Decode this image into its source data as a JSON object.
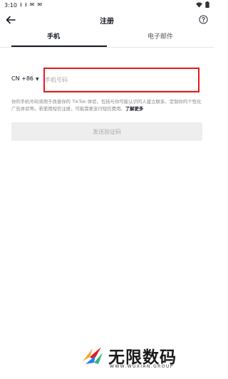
{
  "status_bar": {
    "time": "3:10",
    "icons": [
      "download-icon",
      "download-icon",
      "app-icon",
      "app-icon"
    ],
    "right_icons": [
      "wifi-icon",
      "battery-icon"
    ]
  },
  "header": {
    "title": "注册",
    "back_icon": "arrow-left-icon",
    "help_icon": "help-circle-icon"
  },
  "tabs": [
    {
      "label": "手机",
      "active": true
    },
    {
      "label": "电子邮件",
      "active": false
    }
  ],
  "phone": {
    "country_code": "CN +86",
    "placeholder": "手机号码",
    "value": ""
  },
  "disclaimer": {
    "text": "你的手机号码将用于改善你的 TikTok 体验，包括与你可能认识的人建立联系、定制你的个性化广告体验等。若使用短信注册，可能需要支付短信费用。",
    "learn_more": "了解更多"
  },
  "send_button": {
    "label": "发送验证码"
  },
  "watermark": {
    "title": "无限数码",
    "url": "WWW.WUXIAN.GROUP"
  },
  "colors": {
    "accent_highlight": "#e5191c",
    "disabled_button": "#eeeeee",
    "text_primary": "#161823",
    "text_secondary": "#8a8a8a"
  }
}
